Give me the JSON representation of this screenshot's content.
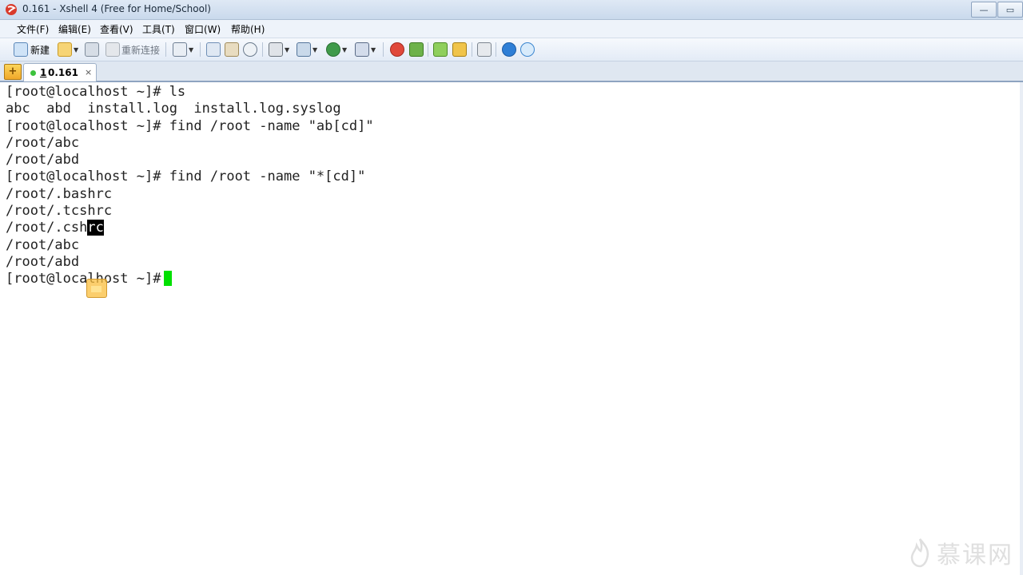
{
  "window": {
    "title": "0.161 - Xshell 4 (Free for Home/School)",
    "controls": {
      "minimize": "—",
      "maximize": "▭"
    }
  },
  "menu": {
    "items": [
      "文件(F)",
      "编辑(E)",
      "查看(V)",
      "工具(T)",
      "窗口(W)",
      "帮助(H)"
    ]
  },
  "toolbar": {
    "new_label": "新建",
    "reconnect_label": "重新连接"
  },
  "tabs": {
    "add_label": "+",
    "session_number": "1",
    "session_name": "0.161",
    "close_label": "×",
    "status_color": "#3cc23c"
  },
  "terminal": {
    "lines": [
      "[root@localhost ~]# ls",
      "abc  abd  install.log  install.log.syslog",
      "[root@localhost ~]# find /root -name \"ab[cd]\"",
      "/root/abc",
      "/root/abd",
      "[root@localhost ~]# find /root -name \"*[cd]\"",
      "/root/.bashrc",
      "/root/.tcshrc"
    ],
    "cshrc_prefix": "/root/.csh",
    "cshrc_selected": "rc",
    "lines_after": [
      "/root/abc",
      "/root/abd"
    ],
    "prompt": "[root@localhost ~]#",
    "cursor_color": "#00e000"
  },
  "watermark": {
    "text": "慕课网"
  }
}
